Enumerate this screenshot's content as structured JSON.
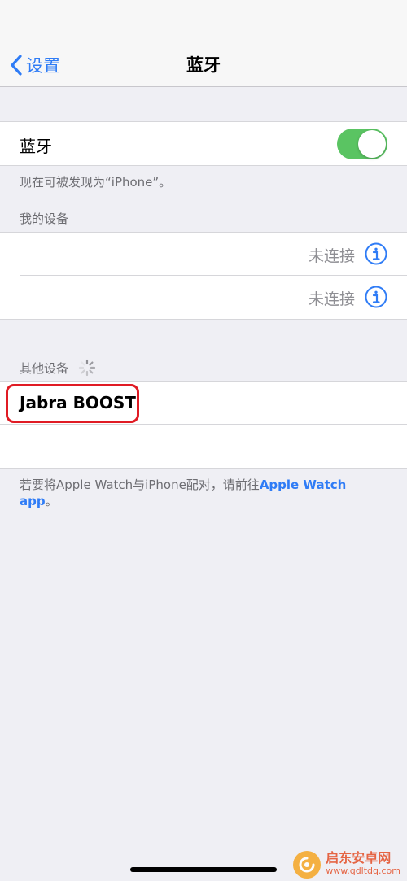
{
  "navbar": {
    "back_label": "设置",
    "title": "蓝牙"
  },
  "bluetooth": {
    "label": "蓝牙",
    "enabled": true,
    "discoverable_note": "现在可被发现为“iPhone”。"
  },
  "my_devices": {
    "header": "我的设备",
    "items": [
      {
        "name": "",
        "status": "未连接"
      },
      {
        "name": "",
        "status": "未连接"
      }
    ]
  },
  "other_devices": {
    "header": "其他设备",
    "items": [
      {
        "name": "Jabra BOOST"
      },
      {
        "name": ""
      }
    ]
  },
  "footer": {
    "text": "若要将Apple Watch与iPhone配对，请前往",
    "link": "Apple Watch app",
    "end": "。"
  },
  "watermark": {
    "name": "启东安卓网",
    "url": "www.qdltdq.com"
  },
  "colors": {
    "accent": "#2f7cf6",
    "toggle_on": "#5ac462",
    "highlight": "#e01b24"
  }
}
